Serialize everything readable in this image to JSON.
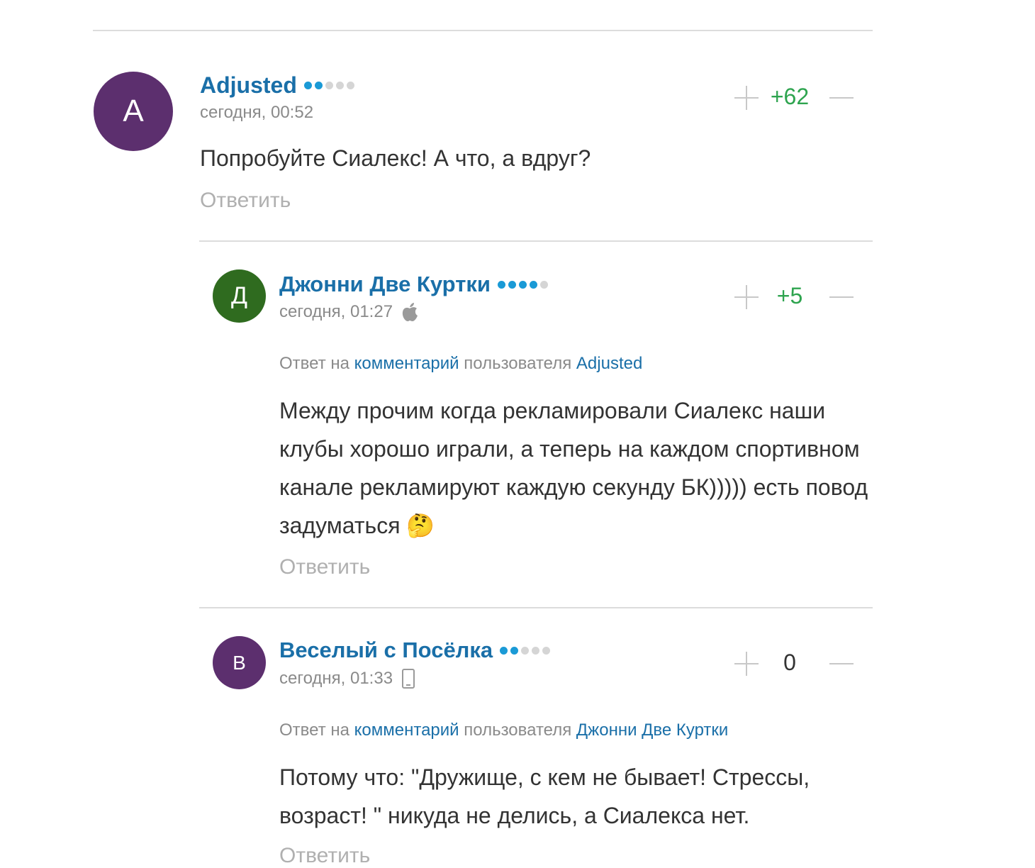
{
  "colors": {
    "link": "#1a6fa8",
    "dot_active": "#1a9ad6",
    "dot_inactive": "#d5d5d5",
    "score_positive": "#2ea44f",
    "muted": "#8a8a8a"
  },
  "comments": [
    {
      "avatar_letter": "A",
      "avatar_color": "#5c2f6e",
      "author": "Adjusted",
      "rating_dots_active": 2,
      "rating_dots_total": 5,
      "timestamp": "сегодня, 00:52",
      "device_icon": "none",
      "score": "+62",
      "body": "Попробуйте Сиалекс! А что, а вдруг?",
      "reply_label": "Ответить"
    },
    {
      "avatar_letter": "Д",
      "avatar_color": "#2f6b1f",
      "author": "Джонни Две Куртки",
      "rating_dots_active": 4,
      "rating_dots_total": 5,
      "timestamp": "сегодня, 01:27",
      "device_icon": "apple-icon",
      "score": "+5",
      "reply_to": {
        "prefix": "Ответ на",
        "comment_link": "комментарий",
        "middle": "пользователя",
        "user_link": "Adjusted"
      },
      "body": "Между прочим когда рекламировали Сиалекс наши клубы хорошо играли, а теперь на каждом спортивном канале рекламируют каждую секунду БК))))) есть повод задуматься 🤔",
      "reply_label": "Ответить"
    },
    {
      "avatar_letter": "В",
      "avatar_color": "#5c2f6e",
      "author": "Веселый с Посёлка",
      "rating_dots_active": 2,
      "rating_dots_total": 5,
      "timestamp": "сегодня, 01:33",
      "device_icon": "mobile-phone-icon",
      "score": "0",
      "reply_to": {
        "prefix": "Ответ на",
        "comment_link": "комментарий",
        "middle": "пользователя",
        "user_link": "Джонни Две Куртки"
      },
      "body": "Потому что: \"Дружище, с кем не бывает! Стрессы, возраст! \" никуда не делись, а Сиалекса нет.",
      "reply_label": "Ответить"
    }
  ]
}
